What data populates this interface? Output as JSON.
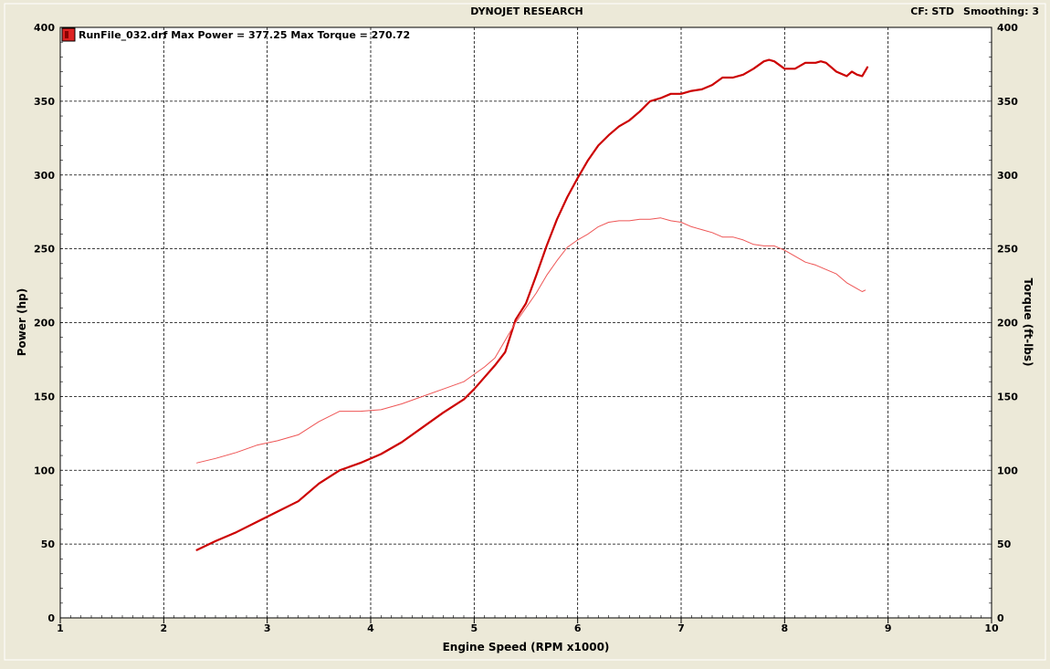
{
  "header": {
    "title": "DYNOJET RESEARCH",
    "cf_label": "CF: STD",
    "smoothing_label": "Smoothing: 3"
  },
  "legend": {
    "entry": "RunFile_032.drf Max Power = 377.25 Max Torque = 270.72"
  },
  "chart_data": {
    "type": "line",
    "title": "",
    "xlabel": "Engine Speed (RPM x1000)",
    "ylabel": "Power (hp)",
    "y2label": "Torque (ft-lbs)",
    "xlim": [
      1,
      10
    ],
    "ylim": [
      0,
      400
    ],
    "y2lim": [
      0,
      400
    ],
    "xticks": [
      "1",
      "2",
      "3",
      "4",
      "5",
      "6",
      "7",
      "8",
      "9",
      "10"
    ],
    "yticks": [
      "0",
      "50",
      "100",
      "150",
      "200",
      "250",
      "300",
      "350",
      "400"
    ],
    "grid": true,
    "legend_position": "top-left",
    "series": [
      {
        "name": "Power",
        "axis": "left",
        "color": "#cc0000",
        "x": [
          2.32,
          2.5,
          2.7,
          2.9,
          3.1,
          3.3,
          3.5,
          3.7,
          3.9,
          4.1,
          4.3,
          4.5,
          4.7,
          4.9,
          5.0,
          5.1,
          5.2,
          5.3,
          5.4,
          5.5,
          5.6,
          5.7,
          5.8,
          5.9,
          6.0,
          6.1,
          6.2,
          6.3,
          6.4,
          6.5,
          6.6,
          6.7,
          6.8,
          6.9,
          7.0,
          7.1,
          7.2,
          7.3,
          7.4,
          7.5,
          7.6,
          7.7,
          7.8,
          7.85,
          7.9,
          8.0,
          8.1,
          8.2,
          8.3,
          8.35,
          8.4,
          8.5,
          8.6,
          8.65,
          8.7,
          8.75,
          8.8
        ],
        "values": [
          46,
          52,
          58,
          65,
          72,
          79,
          91,
          100,
          105,
          111,
          119,
          129,
          139,
          148,
          155,
          163,
          171,
          180,
          202,
          213,
          232,
          252,
          270,
          285,
          298,
          310,
          320,
          327,
          333,
          337,
          343,
          350,
          352,
          355,
          355,
          357,
          358,
          361,
          366,
          366,
          368,
          372,
          377,
          378,
          377,
          372,
          372,
          376,
          376,
          377,
          376,
          370,
          367,
          370,
          368,
          367,
          373
        ]
      },
      {
        "name": "Torque",
        "axis": "right",
        "color": "#ee5555",
        "x": [
          2.32,
          2.5,
          2.7,
          2.9,
          3.1,
          3.3,
          3.5,
          3.7,
          3.9,
          4.1,
          4.3,
          4.5,
          4.7,
          4.9,
          5.0,
          5.1,
          5.2,
          5.3,
          5.4,
          5.5,
          5.6,
          5.7,
          5.8,
          5.9,
          6.0,
          6.1,
          6.2,
          6.3,
          6.4,
          6.5,
          6.6,
          6.7,
          6.8,
          6.9,
          7.0,
          7.1,
          7.2,
          7.3,
          7.4,
          7.5,
          7.6,
          7.7,
          7.8,
          7.9,
          8.0,
          8.1,
          8.2,
          8.3,
          8.4,
          8.5,
          8.6,
          8.7,
          8.75,
          8.78
        ],
        "values": [
          105,
          108,
          112,
          117,
          120,
          124,
          133,
          140,
          140,
          141,
          145,
          150,
          155,
          160,
          165,
          170,
          176,
          188,
          200,
          210,
          220,
          232,
          242,
          251,
          256,
          260,
          265,
          268,
          269,
          269,
          270,
          270,
          271,
          269,
          268,
          265,
          263,
          261,
          258,
          258,
          256,
          253,
          252,
          252,
          249,
          245,
          241,
          239,
          236,
          233,
          227,
          223,
          221,
          222
        ]
      }
    ]
  },
  "colors": {
    "background": "#ece9d8",
    "plot_background": "#ffffff",
    "power_line": "#cc0000",
    "torque_line": "#ee5555"
  }
}
